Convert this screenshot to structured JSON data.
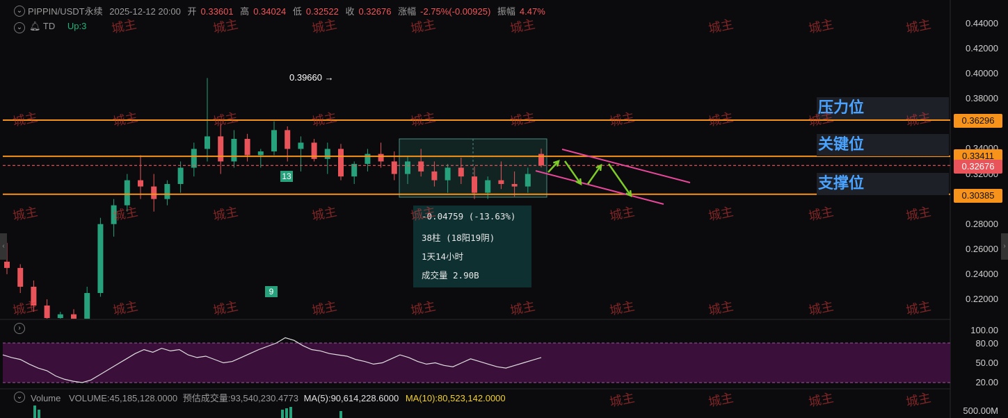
{
  "header": {
    "symbol": "PIPPIN/USDT永续",
    "datetime": "2025-12-12 20:00",
    "open_label": "开",
    "open": "0.33601",
    "high_label": "高",
    "high": "0.34024",
    "low_label": "低",
    "low": "0.32522",
    "close_label": "收",
    "close": "0.32676",
    "change_label": "涨幅",
    "change": "-2.75%(-0.00925)",
    "amplitude_label": "振幅",
    "amplitude": "4.47%"
  },
  "indicator": {
    "name": "TD",
    "status": "Up:3"
  },
  "volume": {
    "label": "Volume",
    "volume_text": "VOLUME:45,185,128.0000",
    "est_text": "预估成交量:93,540,230.4773",
    "ma5_text": "MA(5):90,614,228.6000",
    "ma10_text": "MA(10):80,523,142.0000",
    "axis_label": "500.00M"
  },
  "stats": {
    "change": "-0.04759 (-13.63%)",
    "bars": "38柱 (18阳19阴)",
    "duration": "1天14小时",
    "volume": "成交量 2.90B"
  },
  "zones": {
    "resistance": "压力位",
    "key": "关键位",
    "support": "支撑位"
  },
  "price_tags": {
    "resistance": "0.36296",
    "key": "0.33411",
    "current": "0.32676",
    "support": "0.30385"
  },
  "peak_label": "0.39660 →",
  "td_badges": [
    "13",
    "9"
  ],
  "watermark": "城主",
  "rsi_axis": [
    "100.00",
    "80.00",
    "50.00",
    "20.00"
  ],
  "colors": {
    "up": "#26a17b",
    "down": "#e8545a",
    "level": "#f7931a",
    "channel": "#e8489a",
    "arrow": "#7ecb2a",
    "rsi_bg": "#3a0f3a",
    "zone_text": "#4aa3ff"
  },
  "chart_data": {
    "type": "candlestick",
    "y_ticks": [
      "0.44000",
      "0.42000",
      "0.40000",
      "0.38000",
      "0.36000",
      "0.34000",
      "0.32000",
      "0.30000",
      "0.28000",
      "0.26000",
      "0.24000",
      "0.22000"
    ],
    "ylim": [
      0.2,
      0.45
    ],
    "levels": [
      0.36296,
      0.33411,
      0.30385
    ],
    "current_price": 0.32676,
    "peak": 0.3966,
    "ohlc": [
      [
        0.25,
        0.265,
        0.24,
        0.245
      ],
      [
        0.245,
        0.248,
        0.225,
        0.23
      ],
      [
        0.23,
        0.235,
        0.21,
        0.215
      ],
      [
        0.215,
        0.22,
        0.2,
        0.205
      ],
      [
        0.205,
        0.21,
        0.195,
        0.208
      ],
      [
        0.208,
        0.212,
        0.2,
        0.203
      ],
      [
        0.203,
        0.23,
        0.2,
        0.225
      ],
      [
        0.225,
        0.285,
        0.222,
        0.28
      ],
      [
        0.28,
        0.3,
        0.27,
        0.295
      ],
      [
        0.295,
        0.32,
        0.29,
        0.315
      ],
      [
        0.315,
        0.335,
        0.3,
        0.31
      ],
      [
        0.31,
        0.32,
        0.29,
        0.3
      ],
      [
        0.3,
        0.315,
        0.295,
        0.312
      ],
      [
        0.312,
        0.33,
        0.305,
        0.325
      ],
      [
        0.325,
        0.345,
        0.318,
        0.34
      ],
      [
        0.34,
        0.3966,
        0.33,
        0.35
      ],
      [
        0.35,
        0.36,
        0.32,
        0.33
      ],
      [
        0.33,
        0.355,
        0.325,
        0.348
      ],
      [
        0.348,
        0.352,
        0.33,
        0.335
      ],
      [
        0.335,
        0.34,
        0.325,
        0.338
      ],
      [
        0.338,
        0.362,
        0.335,
        0.355
      ],
      [
        0.355,
        0.358,
        0.33,
        0.34
      ],
      [
        0.34,
        0.35,
        0.322,
        0.345
      ],
      [
        0.345,
        0.348,
        0.33,
        0.332
      ],
      [
        0.332,
        0.345,
        0.32,
        0.34
      ],
      [
        0.34,
        0.344,
        0.315,
        0.318
      ],
      [
        0.318,
        0.33,
        0.312,
        0.328
      ],
      [
        0.328,
        0.34,
        0.322,
        0.336
      ],
      [
        0.336,
        0.345,
        0.325,
        0.33
      ],
      [
        0.33,
        0.338,
        0.315,
        0.32
      ],
      [
        0.32,
        0.334,
        0.312,
        0.33
      ],
      [
        0.33,
        0.34,
        0.318,
        0.322
      ],
      [
        0.322,
        0.33,
        0.31,
        0.315
      ],
      [
        0.315,
        0.328,
        0.305,
        0.325
      ],
      [
        0.325,
        0.333,
        0.312,
        0.318
      ],
      [
        0.318,
        0.326,
        0.3,
        0.305
      ],
      [
        0.305,
        0.318,
        0.3,
        0.315
      ],
      [
        0.315,
        0.33,
        0.308,
        0.312
      ],
      [
        0.312,
        0.322,
        0.302,
        0.31
      ],
      [
        0.31,
        0.325,
        0.305,
        0.32
      ],
      [
        0.336,
        0.3402,
        0.3252,
        0.3268
      ]
    ],
    "rsi": [
      62,
      58,
      55,
      48,
      42,
      38,
      30,
      25,
      22,
      20,
      24,
      32,
      40,
      48,
      56,
      64,
      70,
      66,
      72,
      68,
      70,
      62,
      58,
      60,
      55,
      50,
      52,
      58,
      64,
      70,
      75,
      80,
      88,
      84,
      76,
      70,
      68,
      64,
      62,
      60,
      55,
      52,
      48,
      50,
      56,
      62,
      58,
      52,
      48,
      50,
      46,
      44,
      50,
      56,
      52,
      48,
      44,
      42,
      46,
      50,
      54,
      58
    ]
  }
}
